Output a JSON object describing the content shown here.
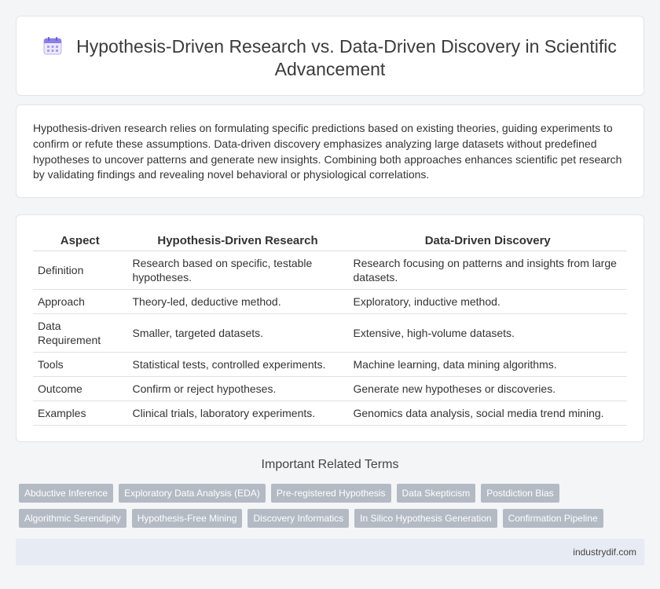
{
  "header": {
    "title": "Hypothesis-Driven Research vs. Data-Driven Discovery in Scientific Advancement",
    "icon": "calendar-icon",
    "icon_color": "#8b7fe8"
  },
  "intro": {
    "text": "Hypothesis-driven research relies on formulating specific predictions based on existing theories, guiding experiments to confirm or refute these assumptions. Data-driven discovery emphasizes analyzing large datasets without predefined hypotheses to uncover patterns and generate new insights. Combining both approaches enhances scientific pet research by validating findings and revealing novel behavioral or physiological correlations."
  },
  "table": {
    "headers": [
      "Aspect",
      "Hypothesis-Driven Research",
      "Data-Driven Discovery"
    ],
    "rows": [
      [
        "Definition",
        "Research based on specific, testable hypotheses.",
        "Research focusing on patterns and insights from large datasets."
      ],
      [
        "Approach",
        "Theory-led, deductive method.",
        "Exploratory, inductive method."
      ],
      [
        "Data Requirement",
        "Smaller, targeted datasets.",
        "Extensive, high-volume datasets."
      ],
      [
        "Tools",
        "Statistical tests, controlled experiments.",
        "Machine learning, data mining algorithms."
      ],
      [
        "Outcome",
        "Confirm or reject hypotheses.",
        "Generate new hypotheses or discoveries."
      ],
      [
        "Examples",
        "Clinical trials, laboratory experiments.",
        "Genomics data analysis, social media trend mining."
      ]
    ]
  },
  "related": {
    "heading": "Important Related Terms",
    "tags": [
      "Abductive Inference",
      "Exploratory Data Analysis (EDA)",
      "Pre-registered Hypothesis",
      "Data Skepticism",
      "Postdiction Bias",
      "Algorithmic Serendipity",
      "Hypothesis-Free Mining",
      "Discovery Informatics",
      "In Silico Hypothesis Generation",
      "Confirmation Pipeline"
    ],
    "tag_color": "#b4bac4"
  },
  "footer": {
    "site": "industrydif.com"
  }
}
